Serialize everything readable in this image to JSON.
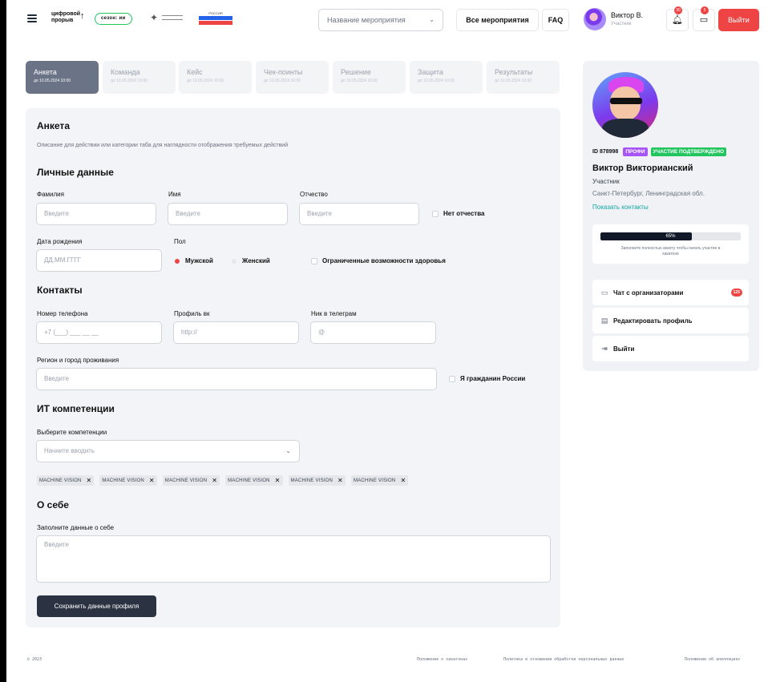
{
  "header": {
    "logo_text_line1": "цифровой",
    "logo_text_line2": "прорыв",
    "season": "сезон: ии",
    "russia_logo_text": "РОССИЯ",
    "event_select_placeholder": "Название мероприятия",
    "all_events": "Все мероприятия",
    "faq": "FAQ",
    "user_name": "Виктор В.",
    "user_role": "Участник",
    "bell_count": "30",
    "chat_count": "5",
    "logout": "Выйти"
  },
  "tabs": [
    {
      "label": "Анкета",
      "date": "до 10.05.2024 10:00",
      "active": true
    },
    {
      "label": "Команда",
      "date": "до 10.05.2024 10:00"
    },
    {
      "label": "Кейс",
      "date": "до 10.05.2024 10:00"
    },
    {
      "label": "Чек-поинты",
      "date": "до 10.05.2024 10:00"
    },
    {
      "label": "Решение",
      "date": "до 10.05.2024 10:00"
    },
    {
      "label": "Защита",
      "date": "до 10.05.2024 10:00"
    },
    {
      "label": "Результаты",
      "date": "до 10.05.2024 10:00"
    }
  ],
  "form": {
    "title": "Анкета",
    "description": "Описание для действии или категории таба для наглядности отображения требуемых действий",
    "personal": {
      "title": "Личные данные",
      "surname_label": "Фамилия",
      "surname_placeholder": "Введите",
      "name_label": "Имя",
      "name_placeholder": "Введите",
      "patronymic_label": "Отчество",
      "patronymic_placeholder": "Введите",
      "no_patronymic": "Нет отчества",
      "birth_label": "Дата рождения",
      "birth_placeholder": "ДД.ММ.ГГГГ",
      "gender_label": "Пол",
      "gender_male": "Мужской",
      "gender_female": "Женский",
      "disability": "Ограниченные возможности здоровья"
    },
    "contacts": {
      "title": "Контакты",
      "phone_label": "Номер телефона",
      "phone_placeholder": "+7 (___) ___ __ __",
      "vk_label": "Профиль вк",
      "vk_placeholder": "http://",
      "tg_label": "Ник в телеграм",
      "tg_placeholder": "@",
      "region_label": "Регион и город проживания",
      "region_placeholder": "Введите",
      "citizen": "Я гражданин России"
    },
    "it": {
      "title": "ИТ компетенции",
      "select_label": "Выберите компетенции",
      "select_placeholder": "Начните вводить",
      "tags": [
        "MACHINE VISION",
        "MACHINE VISION",
        "MACHINE VISION",
        "MACHINE VISION",
        "MACHINE VISION",
        "MACHINE VISION"
      ]
    },
    "about": {
      "title": "О себе",
      "label": "Заполните данные о себе",
      "placeholder": "Введите"
    },
    "save": "Сохранить данные профиля"
  },
  "profile": {
    "id": "ID 878998",
    "badge_level": "ПРОФИ",
    "badge_status": "УЧАСТИЕ ПОДТВЕРЖДЕНО",
    "name": "Виктор Викторианский",
    "role": "Участник",
    "city": "Санкт-Петербург, Ленинградская обл.",
    "contacts_link": "Показать контакты",
    "progress_text": "65%",
    "progress_value": 0.65,
    "progress_note": "Заполните полностью анкету чтобы начать участие в хакатоне",
    "menu": [
      {
        "label": "Чат с организаторами",
        "count": "125"
      },
      {
        "label": "Редактировать профиль"
      },
      {
        "label": "Выйти"
      }
    ]
  },
  "footer": {
    "copyright": "© 2023",
    "links": [
      "Положение о хакатонах",
      "Политика в отношении обработки персональных данных",
      "Положение об апелляциях"
    ]
  }
}
